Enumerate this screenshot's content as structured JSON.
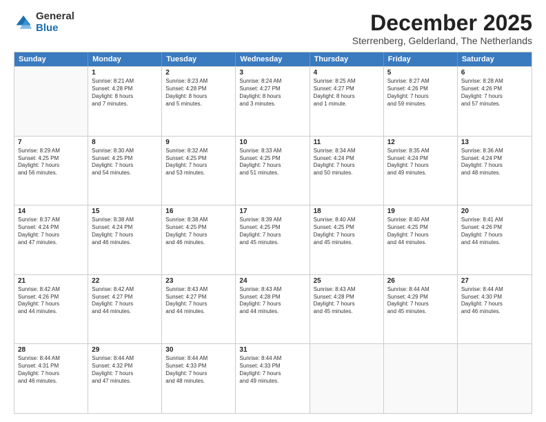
{
  "logo": {
    "general": "General",
    "blue": "Blue"
  },
  "header": {
    "month": "December 2025",
    "location": "Sterrenberg, Gelderland, The Netherlands"
  },
  "days": [
    "Sunday",
    "Monday",
    "Tuesday",
    "Wednesday",
    "Thursday",
    "Friday",
    "Saturday"
  ],
  "weeks": [
    [
      {
        "day": "",
        "content": ""
      },
      {
        "day": "1",
        "content": "Sunrise: 8:21 AM\nSunset: 4:28 PM\nDaylight: 8 hours\nand 7 minutes."
      },
      {
        "day": "2",
        "content": "Sunrise: 8:23 AM\nSunset: 4:28 PM\nDaylight: 8 hours\nand 5 minutes."
      },
      {
        "day": "3",
        "content": "Sunrise: 8:24 AM\nSunset: 4:27 PM\nDaylight: 8 hours\nand 3 minutes."
      },
      {
        "day": "4",
        "content": "Sunrise: 8:25 AM\nSunset: 4:27 PM\nDaylight: 8 hours\nand 1 minute."
      },
      {
        "day": "5",
        "content": "Sunrise: 8:27 AM\nSunset: 4:26 PM\nDaylight: 7 hours\nand 59 minutes."
      },
      {
        "day": "6",
        "content": "Sunrise: 8:28 AM\nSunset: 4:26 PM\nDaylight: 7 hours\nand 57 minutes."
      }
    ],
    [
      {
        "day": "7",
        "content": "Sunrise: 8:29 AM\nSunset: 4:25 PM\nDaylight: 7 hours\nand 56 minutes."
      },
      {
        "day": "8",
        "content": "Sunrise: 8:30 AM\nSunset: 4:25 PM\nDaylight: 7 hours\nand 54 minutes."
      },
      {
        "day": "9",
        "content": "Sunrise: 8:32 AM\nSunset: 4:25 PM\nDaylight: 7 hours\nand 53 minutes."
      },
      {
        "day": "10",
        "content": "Sunrise: 8:33 AM\nSunset: 4:25 PM\nDaylight: 7 hours\nand 51 minutes."
      },
      {
        "day": "11",
        "content": "Sunrise: 8:34 AM\nSunset: 4:24 PM\nDaylight: 7 hours\nand 50 minutes."
      },
      {
        "day": "12",
        "content": "Sunrise: 8:35 AM\nSunset: 4:24 PM\nDaylight: 7 hours\nand 49 minutes."
      },
      {
        "day": "13",
        "content": "Sunrise: 8:36 AM\nSunset: 4:24 PM\nDaylight: 7 hours\nand 48 minutes."
      }
    ],
    [
      {
        "day": "14",
        "content": "Sunrise: 8:37 AM\nSunset: 4:24 PM\nDaylight: 7 hours\nand 47 minutes."
      },
      {
        "day": "15",
        "content": "Sunrise: 8:38 AM\nSunset: 4:24 PM\nDaylight: 7 hours\nand 46 minutes."
      },
      {
        "day": "16",
        "content": "Sunrise: 8:38 AM\nSunset: 4:25 PM\nDaylight: 7 hours\nand 46 minutes."
      },
      {
        "day": "17",
        "content": "Sunrise: 8:39 AM\nSunset: 4:25 PM\nDaylight: 7 hours\nand 45 minutes."
      },
      {
        "day": "18",
        "content": "Sunrise: 8:40 AM\nSunset: 4:25 PM\nDaylight: 7 hours\nand 45 minutes."
      },
      {
        "day": "19",
        "content": "Sunrise: 8:40 AM\nSunset: 4:25 PM\nDaylight: 7 hours\nand 44 minutes."
      },
      {
        "day": "20",
        "content": "Sunrise: 8:41 AM\nSunset: 4:26 PM\nDaylight: 7 hours\nand 44 minutes."
      }
    ],
    [
      {
        "day": "21",
        "content": "Sunrise: 8:42 AM\nSunset: 4:26 PM\nDaylight: 7 hours\nand 44 minutes."
      },
      {
        "day": "22",
        "content": "Sunrise: 8:42 AM\nSunset: 4:27 PM\nDaylight: 7 hours\nand 44 minutes."
      },
      {
        "day": "23",
        "content": "Sunrise: 8:43 AM\nSunset: 4:27 PM\nDaylight: 7 hours\nand 44 minutes."
      },
      {
        "day": "24",
        "content": "Sunrise: 8:43 AM\nSunset: 4:28 PM\nDaylight: 7 hours\nand 44 minutes."
      },
      {
        "day": "25",
        "content": "Sunrise: 8:43 AM\nSunset: 4:28 PM\nDaylight: 7 hours\nand 45 minutes."
      },
      {
        "day": "26",
        "content": "Sunrise: 8:44 AM\nSunset: 4:29 PM\nDaylight: 7 hours\nand 45 minutes."
      },
      {
        "day": "27",
        "content": "Sunrise: 8:44 AM\nSunset: 4:30 PM\nDaylight: 7 hours\nand 46 minutes."
      }
    ],
    [
      {
        "day": "28",
        "content": "Sunrise: 8:44 AM\nSunset: 4:31 PM\nDaylight: 7 hours\nand 46 minutes."
      },
      {
        "day": "29",
        "content": "Sunrise: 8:44 AM\nSunset: 4:32 PM\nDaylight: 7 hours\nand 47 minutes."
      },
      {
        "day": "30",
        "content": "Sunrise: 8:44 AM\nSunset: 4:33 PM\nDaylight: 7 hours\nand 48 minutes."
      },
      {
        "day": "31",
        "content": "Sunrise: 8:44 AM\nSunset: 4:33 PM\nDaylight: 7 hours\nand 49 minutes."
      },
      {
        "day": "",
        "content": ""
      },
      {
        "day": "",
        "content": ""
      },
      {
        "day": "",
        "content": ""
      }
    ]
  ]
}
